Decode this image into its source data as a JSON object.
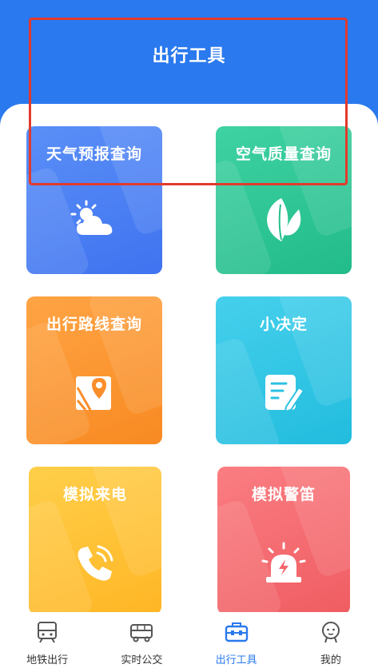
{
  "header": {
    "title": "出行工具"
  },
  "tiles": [
    {
      "label": "天气预报查询",
      "icon": "weather-icon"
    },
    {
      "label": "空气质量查询",
      "icon": "leaf-icon"
    },
    {
      "label": "出行路线查询",
      "icon": "map-pin-icon"
    },
    {
      "label": "小决定",
      "icon": "note-pen-icon"
    },
    {
      "label": "模拟来电",
      "icon": "phone-ring-icon"
    },
    {
      "label": "模拟警笛",
      "icon": "siren-icon"
    }
  ],
  "tabbar": {
    "items": [
      {
        "label": "地铁出行",
        "icon": "subway-icon"
      },
      {
        "label": "实时公交",
        "icon": "bus-icon"
      },
      {
        "label": "出行工具",
        "icon": "toolbox-icon",
        "active": true
      },
      {
        "label": "我的",
        "icon": "profile-icon"
      }
    ]
  },
  "colors": {
    "accent": "#2a79ee",
    "highlight": "#e23a2d",
    "weather": "#4a7ff4",
    "air": "#2cc396",
    "route": "#fb9533",
    "decide": "#30c4e4",
    "call": "#ffbf33",
    "alarm": "#f3666b"
  }
}
